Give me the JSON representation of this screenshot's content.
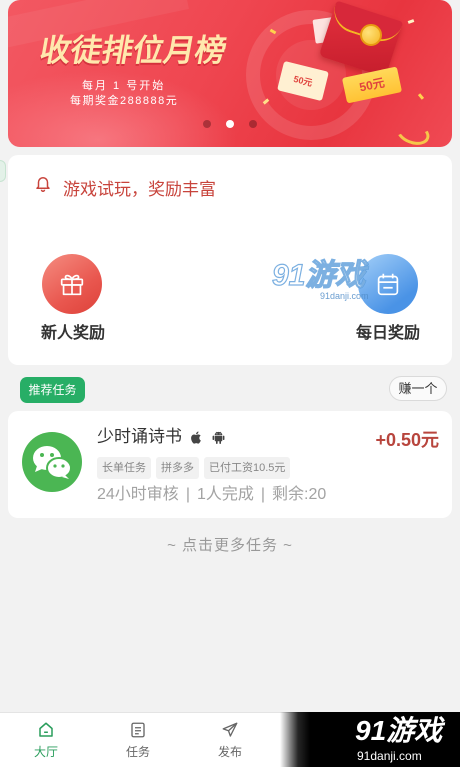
{
  "theme": {
    "accent": "#27ae66",
    "banner_red": "#ef4650",
    "notice_text": "#c8443c",
    "price": "#b8453d",
    "gift_circle": "#e9574f",
    "calendar_circle": "#4a93e6",
    "wechat_green": "#4bb653",
    "tab_active": "#2a9d5c",
    "tab_inactive": "#666666",
    "page_bg": "#f2f2f2"
  },
  "banner": {
    "title": "收徒排位月榜",
    "start_note": "每月 1 号开始",
    "prize_note": "每期奖金288888元",
    "coupon_left": "50元",
    "coupon_right": "50元",
    "slide_count": 3,
    "active_slide": 2
  },
  "notice": {
    "icon": "bell-icon",
    "text": "游戏试玩，奖励丰富"
  },
  "rewards": [
    {
      "label": "新人奖励",
      "icon": "gift-icon"
    },
    {
      "label": "每日奖励",
      "icon": "calendar-icon"
    }
  ],
  "recommend": {
    "title": "推荐任务",
    "action": "赚一个"
  },
  "tasks": [
    {
      "icon": "wechat-icon",
      "title": "少时诵诗书",
      "platform_icons": [
        "apple-icon",
        "android-icon"
      ],
      "reward": "+0.50元",
      "tags": [
        "长单任务",
        "拼多多",
        "已付工资10.5元"
      ],
      "stats": [
        "24小时审核",
        "1人完成",
        "剩余:20"
      ],
      "stats_separator": "|"
    }
  ],
  "more_link": "~ 点击更多任务 ~",
  "tabbar": {
    "items": [
      {
        "label": "大厅",
        "icon": "home-icon",
        "active": true
      },
      {
        "label": "任务",
        "icon": "task-list-icon",
        "active": false
      },
      {
        "label": "发布",
        "icon": "send-icon",
        "active": false
      }
    ]
  },
  "watermark": {
    "brand": "91游戏",
    "site": "91danji.com"
  }
}
